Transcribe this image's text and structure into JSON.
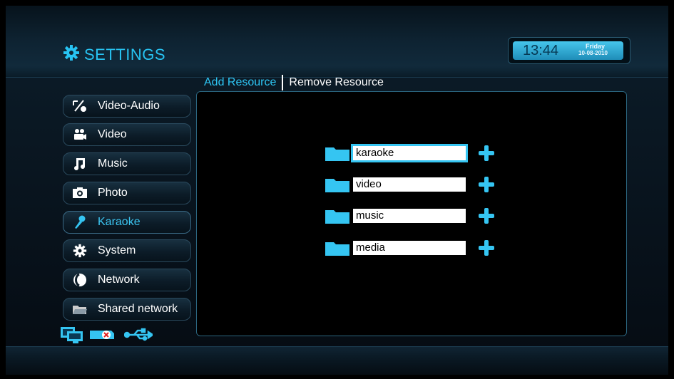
{
  "header": {
    "title": "SETTINGS"
  },
  "clock": {
    "time": "13:44",
    "day": "Friday",
    "date": "10-08-2010"
  },
  "tabs": [
    {
      "label": "Add Resource",
      "active": true
    },
    {
      "label": "Remove Resource",
      "active": false
    }
  ],
  "sidebar": {
    "items": [
      {
        "label": "Video-Audio",
        "icon": "video-audio-icon"
      },
      {
        "label": "Video",
        "icon": "camera-icon"
      },
      {
        "label": "Music",
        "icon": "music-note-icon"
      },
      {
        "label": "Photo",
        "icon": "photo-camera-icon"
      },
      {
        "label": "Karaoke",
        "icon": "microphone-icon",
        "active": true
      },
      {
        "label": "System",
        "icon": "gear-icon"
      },
      {
        "label": "Network",
        "icon": "network-icon"
      },
      {
        "label": "Shared network",
        "icon": "shared-folder-icon"
      }
    ]
  },
  "resources": [
    {
      "name": "karaoke",
      "focused": true
    },
    {
      "name": "video"
    },
    {
      "name": "music"
    },
    {
      "name": "media"
    }
  ],
  "status_icons": [
    "monitor-icon",
    "sd-card-icon",
    "usb-icon"
  ],
  "colors": {
    "accent": "#35c5f2",
    "panel_border": "#2b6680"
  }
}
